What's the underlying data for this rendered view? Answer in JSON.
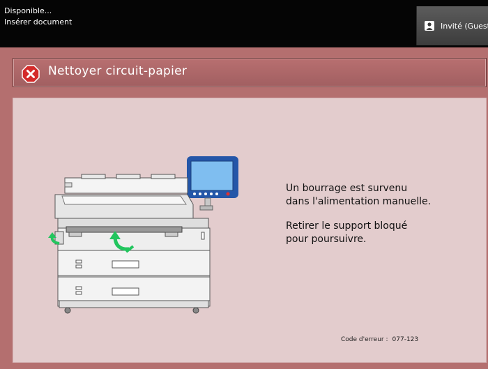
{
  "status": {
    "line1": "Disponible...",
    "line2": "Insérer document"
  },
  "user": {
    "label": "Invité (Guest",
    "icon": "guest-user-icon"
  },
  "dialog": {
    "title": "Nettoyer circuit-papier",
    "title_icon": "error-x-icon",
    "message1_line1": "Un bourrage est survenu",
    "message1_line2": "dans l'alimentation manuelle.",
    "message2_line1": "Retirer le support bloqué",
    "message2_line2": "pour poursuivre.",
    "error_code_label": "Code d'erreur :",
    "error_code": "077-123"
  },
  "colors": {
    "error_red": "#d42a2a",
    "arrow_green": "#22c55e",
    "screen_blue": "#2f7bd9"
  }
}
